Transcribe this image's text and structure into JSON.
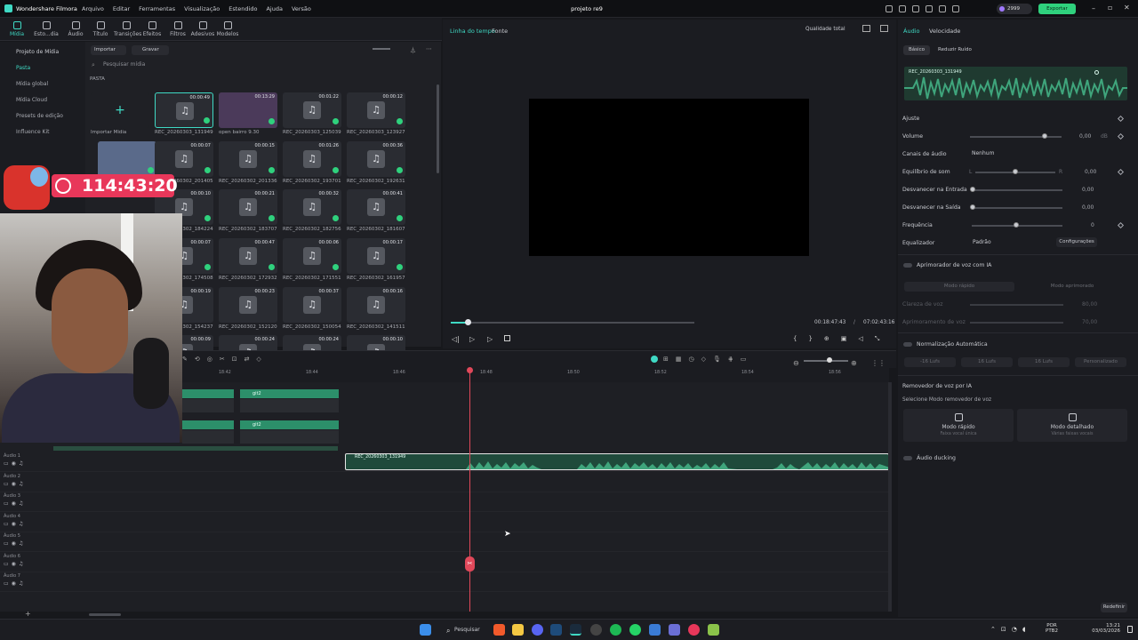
{
  "app": {
    "name": "Wondershare Filmora",
    "project_title": "projeto re9",
    "menu": [
      "Arquivo",
      "Editar",
      "Ferramentas",
      "Visualização",
      "Estendido",
      "Ajuda",
      "Versão"
    ],
    "credits": "2999",
    "export_label": "Exportar"
  },
  "toolbar": {
    "tabs": [
      "Mídia",
      "Esto...dia",
      "Áudio",
      "Título",
      "Transições",
      "Efeitos",
      "Filtros",
      "Adesivos",
      "Modelos"
    ]
  },
  "media_sidebar": {
    "items": [
      "Projeto de Mídia",
      "Pasta",
      "Mídia global",
      "Mídia Cloud",
      "Presets de edição",
      "Influence Kit"
    ]
  },
  "media": {
    "import_label": "Importar",
    "record_label": "Gravar",
    "search_placeholder": "Pesquisar mídia",
    "folder_label": "PASTA",
    "import_media_label": "Importar Mídia",
    "items": [
      {
        "name": "REC_20260303_131949",
        "dur": "00:00:49"
      },
      {
        "name": "open bairro 9.30",
        "dur": "00:13:29"
      },
      {
        "name": "REC_20260303_125039",
        "dur": "00:01:22"
      },
      {
        "name": "REC_20260303_123927",
        "dur": "00:00:12"
      },
      {
        "name": "",
        "dur": ""
      },
      {
        "name": "REC_20260302_201405",
        "dur": "00:00:07"
      },
      {
        "name": "REC_20260302_201336",
        "dur": "00:00:15"
      },
      {
        "name": "REC_20260302_193701",
        "dur": "00:01:26"
      },
      {
        "name": "REC_20260302_192631",
        "dur": "00:00:36"
      },
      {
        "name": "REC_20260302_184224",
        "dur": "00:00:10"
      },
      {
        "name": "REC_20260302_183707",
        "dur": "00:00:21"
      },
      {
        "name": "REC_20260302_182756",
        "dur": "00:00:32"
      },
      {
        "name": "REC_20260302_181607",
        "dur": "00:00:41"
      },
      {
        "name": "REC_20260302_174508",
        "dur": "00:00:07"
      },
      {
        "name": "REC_20260302_172932",
        "dur": "00:00:47"
      },
      {
        "name": "REC_20260302_171551",
        "dur": "00:00:06"
      },
      {
        "name": "REC_20260302_161957",
        "dur": "00:00:17"
      },
      {
        "name": "REC_20260302_154237",
        "dur": "00:00:19"
      },
      {
        "name": "REC_20260302_152120",
        "dur": "00:00:23"
      },
      {
        "name": "REC_20260302_150054",
        "dur": "00:00:37"
      },
      {
        "name": "REC_20260302_141511",
        "dur": "00:00:16"
      },
      {
        "name": "",
        "dur": "00:00:09"
      },
      {
        "name": "",
        "dur": "00:00:24"
      },
      {
        "name": "",
        "dur": "00:00:24"
      },
      {
        "name": "",
        "dur": "00:00:10"
      }
    ]
  },
  "stream_timer": "114:43:20",
  "preview": {
    "tab_timeline": "Linha do tempo",
    "tab_source": "Fonte",
    "quality": "Qualidade total",
    "current_time": "00:18:47:43",
    "separator": "/",
    "total_time": "07:02:43:16",
    "progress": 0.07
  },
  "right_panel": {
    "tabs": [
      "Áudio",
      "Velocidade"
    ],
    "subtabs": [
      "Básico",
      "Reduzir Ruído"
    ],
    "clip_name": "REC_20260303_131949",
    "section_adjust": "Ajuste",
    "volume_label": "Volume",
    "volume_value": "0,00",
    "volume_unit": "dB",
    "channels_label": "Canais de áudio",
    "channels_value": "Nenhum",
    "balance_label": "Equilíbrio de som",
    "balance_left": "L",
    "balance_right": "R",
    "balance_value": "0,00",
    "fadein_label": "Desvanecer na Entrada",
    "fadein_value": "0,00",
    "fadeout_label": "Desvanecer na Saída",
    "fadeout_value": "0,00",
    "freq_label": "Frequência",
    "freq_value": "0",
    "eq_label": "Equalizador",
    "eq_value": "Padrão",
    "eq_config": "Configurações",
    "ai_voice_enhancer": "Aprimorador de voz com IA",
    "mode_fast": "Modo rápido",
    "mode_enhanced": "Modo aprimorado",
    "voice_clarity": "Clareza de voz",
    "voice_clarity_value": "80,00",
    "voice_refine": "Aprimoramento de voz",
    "voice_refine_value": "70,00",
    "auto_normalization": "Normalização Automática",
    "norm_opts": [
      "-16 Lufs",
      "16 Lufs",
      "16 Lufs",
      "Personalizado"
    ],
    "voice_remover": "Removedor de voz por IA",
    "voice_remover_sub": "Selecione Modo removedor de voz",
    "remover_fast": "Modo rápido",
    "remover_fast_sub": "Faixa vocal única",
    "remover_detailed": "Modo detalhado",
    "remover_detailed_sub": "Várias faixas vocais",
    "audio_ducking": "Áudio ducking",
    "reset_label": "Redefinir"
  },
  "timeline": {
    "ruler": [
      "18:42",
      "18:44",
      "18:46",
      "18:48",
      "18:50",
      "18:52",
      "18:54",
      "18:56"
    ],
    "clip_name": "REC_20260303_131949",
    "video_clip_label": "git2",
    "tracks": [
      "Áudio 1",
      "Áudio 2",
      "Áudio 3",
      "Áudio 4",
      "Áudio 5",
      "Áudio 6",
      "Áudio 7"
    ]
  },
  "taskbar": {
    "search_label": "Pesquisar",
    "lang": "POR",
    "layout": "PTB2",
    "time": "13:21",
    "date": "03/03/2026"
  },
  "colors": {
    "accent": "#3fd9c4",
    "waveform": "#3fa57c",
    "playhead": "#e0485a",
    "export_bg": "#2fd17d",
    "timer_bg": "#e8375a"
  }
}
